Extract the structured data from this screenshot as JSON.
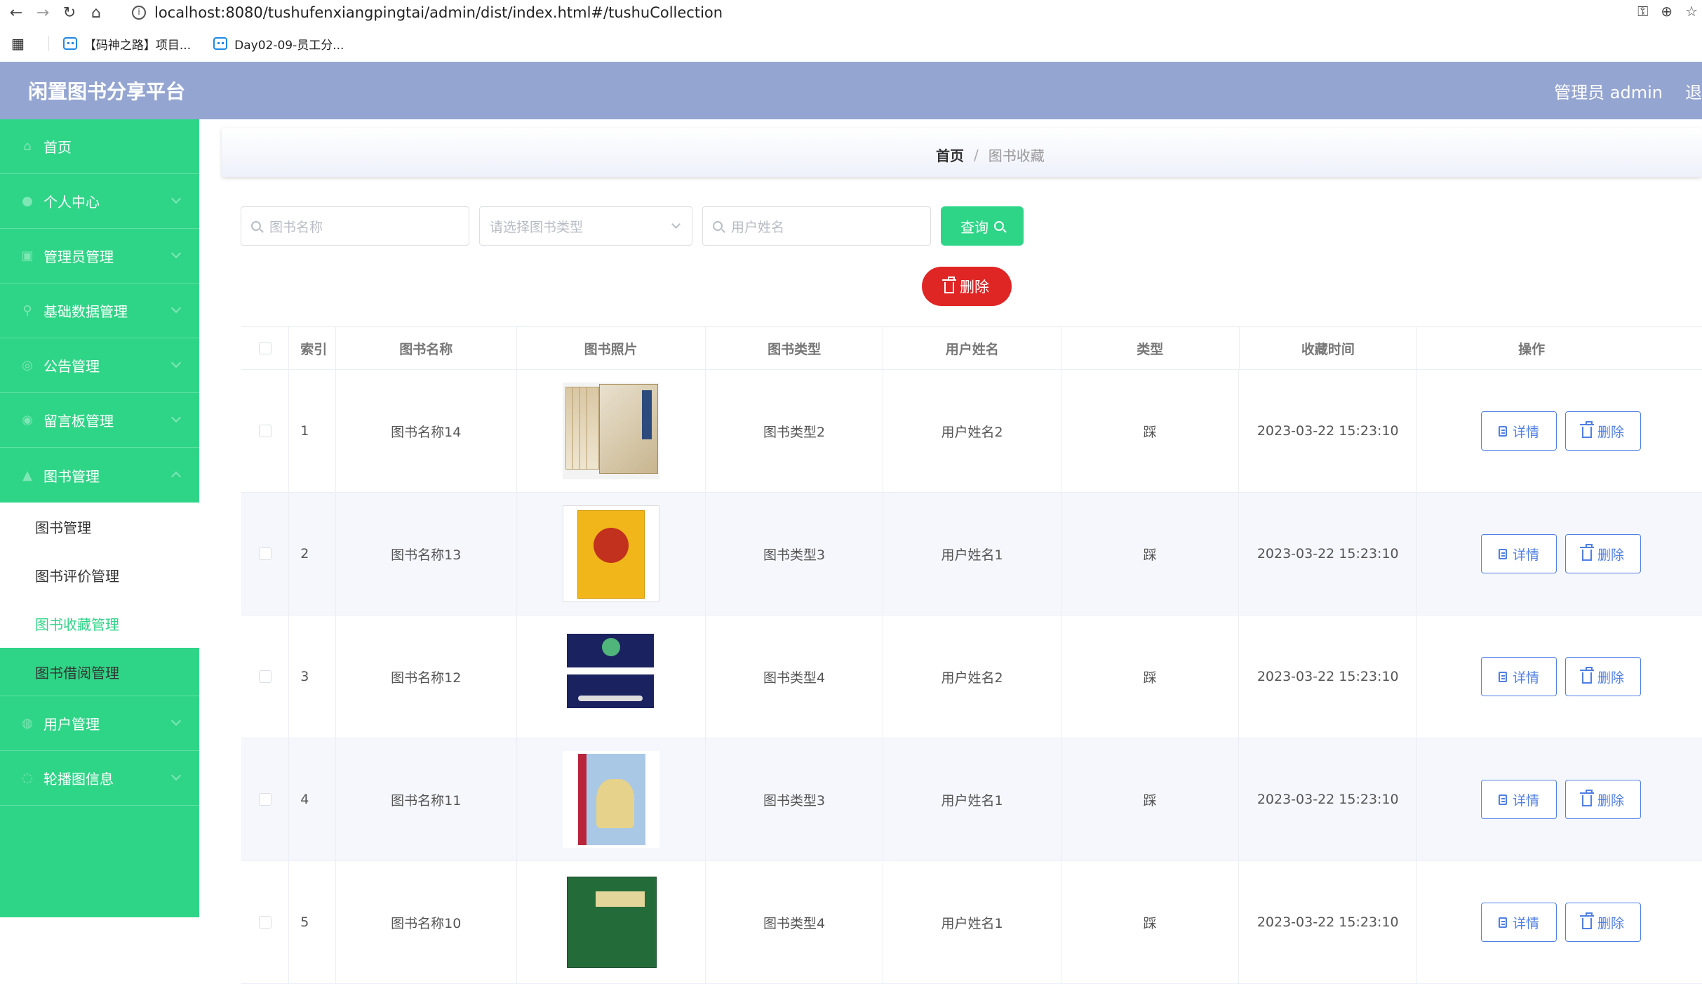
{
  "browser": {
    "url": "localhost:8080/tushufenxiangpingtai/admin/dist/index.html#/tushuCollection",
    "bookmarks": [
      "【码神之路】项目...",
      "Day02-09-员工分..."
    ]
  },
  "header": {
    "title": "闲置图书分享平台",
    "user": "管理员 admin",
    "logout": "退出登录"
  },
  "sidebar": {
    "items": [
      {
        "label": "首页",
        "icon": "home-icon"
      },
      {
        "label": "个人中心",
        "icon": "user-icon"
      },
      {
        "label": "管理员管理",
        "icon": "admin-icon"
      },
      {
        "label": "基础数据管理",
        "icon": "data-icon"
      },
      {
        "label": "公告管理",
        "icon": "notice-icon"
      },
      {
        "label": "留言板管理",
        "icon": "message-icon"
      },
      {
        "label": "图书管理",
        "icon": "book-icon"
      },
      {
        "label": "用户管理",
        "icon": "users-icon"
      },
      {
        "label": "轮播图信息",
        "icon": "carousel-icon"
      }
    ],
    "submenu": [
      "图书管理",
      "图书评价管理",
      "图书收藏管理",
      "图书借阅管理"
    ]
  },
  "breadcrumb": {
    "home": "首页",
    "separator": "/",
    "current": "图书收藏"
  },
  "search": {
    "book_name_placeholder": "图书名称",
    "book_type_placeholder": "请选择图书类型",
    "user_name_placeholder": "用户姓名",
    "query_label": "查询"
  },
  "toolbar": {
    "delete_label": "删除"
  },
  "table": {
    "headers": [
      "索引",
      "图书名称",
      "图书照片",
      "图书类型",
      "用户姓名",
      "类型",
      "收藏时间",
      "操作"
    ],
    "rows": [
      {
        "idx": "1",
        "name": "图书名称14",
        "type": "图书类型2",
        "user": "用户姓名2",
        "kind": "踩",
        "time": "2023-03-22 15:23:10"
      },
      {
        "idx": "2",
        "name": "图书名称13",
        "type": "图书类型3",
        "user": "用户姓名1",
        "kind": "踩",
        "time": "2023-03-22 15:23:10"
      },
      {
        "idx": "3",
        "name": "图书名称12",
        "type": "图书类型4",
        "user": "用户姓名2",
        "kind": "踩",
        "time": "2023-03-22 15:23:10"
      },
      {
        "idx": "4",
        "name": "图书名称11",
        "type": "图书类型3",
        "user": "用户姓名1",
        "kind": "踩",
        "time": "2023-03-22 15:23:10"
      },
      {
        "idx": "5",
        "name": "图书名称10",
        "type": "图书类型4",
        "user": "用户姓名1",
        "kind": "踩",
        "time": "2023-03-22 15:23:10"
      }
    ],
    "detail_label": "详情",
    "delete_label": "删除"
  },
  "colors": {
    "primary": "#2fd587",
    "header": "#94a5d2",
    "danger": "#e02525",
    "link": "#4f7fe6"
  }
}
